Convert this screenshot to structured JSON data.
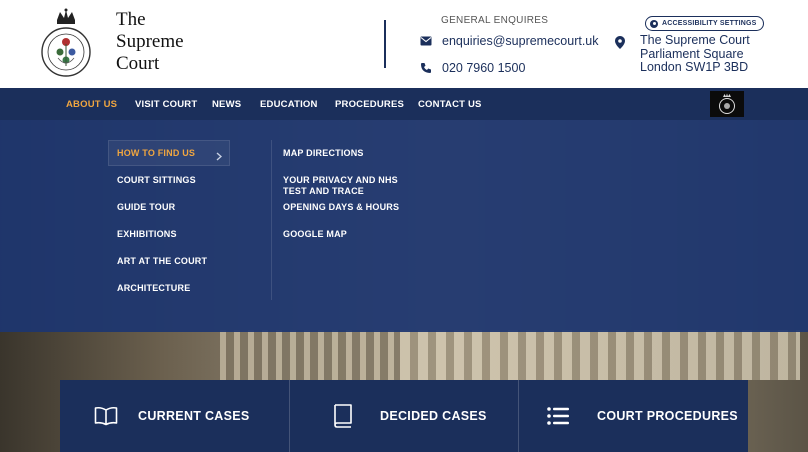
{
  "logo": {
    "lines": [
      "The",
      "Supreme",
      "Court"
    ]
  },
  "contact": {
    "general_label": "GENERAL ENQUIRES",
    "email": "enquiries@supremecourt.uk",
    "phone": "020 7960 1500"
  },
  "accessibility": {
    "label": "ACCESSIBILITY SETTINGS"
  },
  "address": {
    "lines": [
      "The Supreme Court",
      "Parliament Square",
      "London  SW1P 3BD"
    ]
  },
  "nav": {
    "items": [
      {
        "label": "ABOUT US",
        "active": true
      },
      {
        "label": "VISIT COURT"
      },
      {
        "label": "NEWS"
      },
      {
        "label": "EDUCATION"
      },
      {
        "label": "PROCEDURES"
      },
      {
        "label": "CONTACT US"
      }
    ]
  },
  "dropdown": {
    "left": [
      {
        "label": "HOW TO FIND US",
        "active": true
      },
      {
        "label": "COURT SITTINGS"
      },
      {
        "label": "GUIDE TOUR"
      },
      {
        "label": "EXHIBITIONS"
      },
      {
        "label": "ART AT THE COURT"
      },
      {
        "label": "ARCHITECTURE"
      }
    ],
    "right": [
      {
        "label": "MAP DIRECTIONS"
      },
      {
        "label": "YOUR PRIVACY AND NHS TEST AND TRACE"
      },
      {
        "label": "OPENING DAYS & HOURS"
      },
      {
        "label": "GOOGLE MAP"
      }
    ]
  },
  "cards": [
    {
      "label": "CURRENT CASES",
      "icon": "open-book-icon"
    },
    {
      "label": "DECIDED CASES",
      "icon": "closed-book-icon"
    },
    {
      "label": "COURT PROCEDURES",
      "icon": "list-icon"
    }
  ],
  "colors": {
    "navy": "#1b2f5b",
    "accent": "#f0a640",
    "dropdown": "#1d3670"
  }
}
